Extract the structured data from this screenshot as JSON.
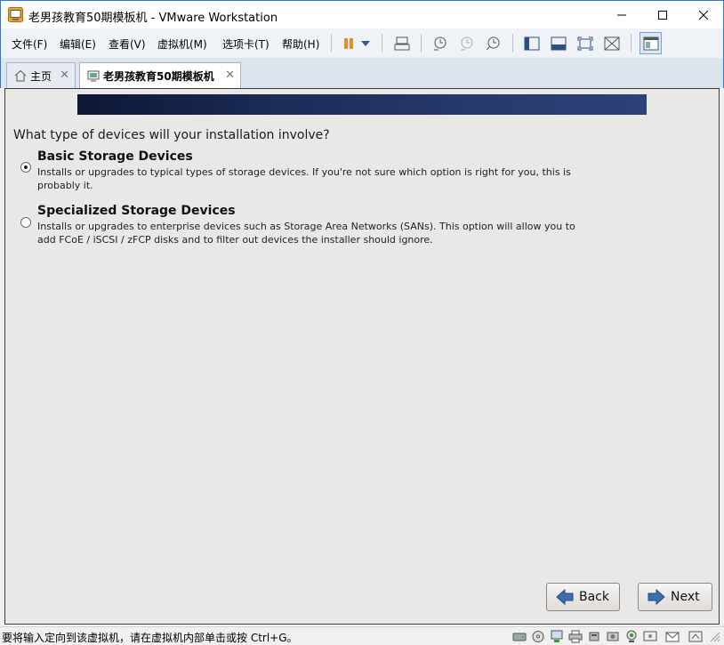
{
  "window": {
    "title": "老男孩教育50期模板机 - VMware Workstation",
    "minimize": "—",
    "maximize": "☐",
    "close": "✕"
  },
  "menu": [
    "文件(F)",
    "编辑(E)",
    "查看(V)",
    "虚拟机(M)",
    "选项卡(T)",
    "帮助(H)"
  ],
  "toolbar_icons": [
    "pause-icon",
    "dropdown-arrow-icon",
    "send-ctrl-alt-del-icon",
    "snapshot-icon",
    "revert-snapshot-icon",
    "snapshot-manager-icon",
    "console-view-icon",
    "thumbnail-view-icon",
    "fullscreen-icon",
    "unity-icon",
    "library-icon"
  ],
  "tabs": [
    {
      "label": "主页",
      "icon": "home-icon",
      "active": false
    },
    {
      "label": "老男孩教育50期模板机",
      "icon": "vm-icon",
      "active": true
    }
  ],
  "installer": {
    "question": "What type of devices will your installation involve?",
    "options": [
      {
        "title": "Basic Storage Devices",
        "description": "Installs or upgrades to typical types of storage devices.  If you're not sure which option is right for you, this is probably it.",
        "selected": true
      },
      {
        "title": "Specialized Storage Devices",
        "description": "Installs or upgrades to enterprise devices such as Storage Area Networks (SANs). This option will allow you to add FCoE / iSCSI / zFCP disks and to filter out devices the installer should ignore.",
        "selected": false
      }
    ],
    "back_label": "Back",
    "next_label": "Next"
  },
  "status": {
    "text": "要将输入定向到该虚拟机，请在虚拟机内部单击或按 Ctrl+G。",
    "icons": [
      "hard-disk-icon",
      "cd-dvd-icon",
      "network-icon",
      "printer-icon",
      "usb-icon",
      "sound-icon",
      "camera-icon",
      "display-icon",
      "message-icon",
      "fit-icon"
    ]
  },
  "colors": {
    "accent": "#2b79d0",
    "pause_orange": "#e8892a",
    "banner_dark": "#0d1735",
    "guest_bg": "#eae8e6"
  }
}
